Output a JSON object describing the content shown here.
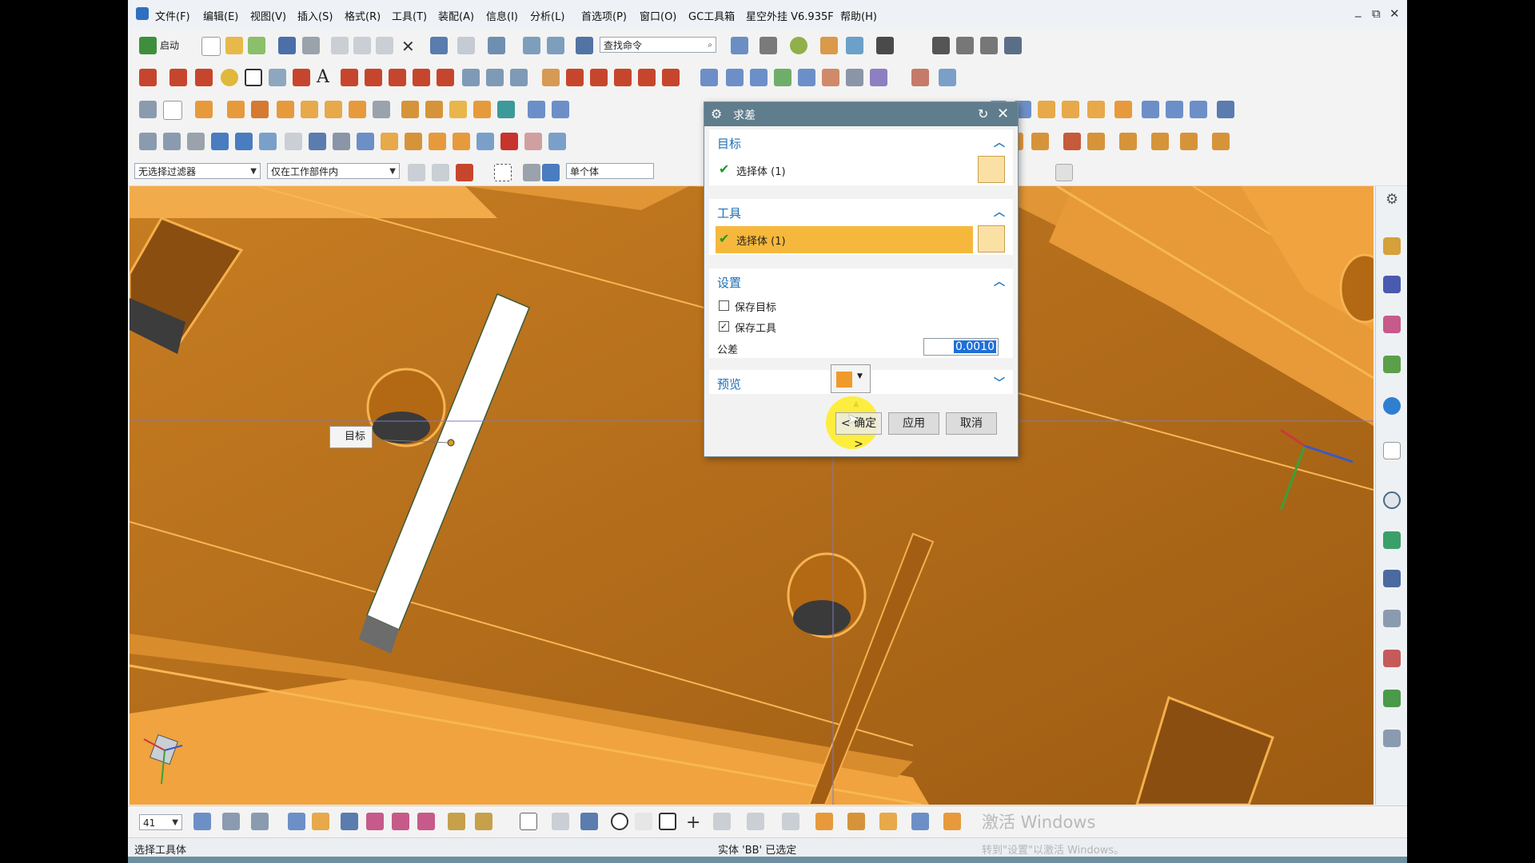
{
  "menubar": {
    "items": [
      "文件(F)",
      "编辑(E)",
      "视图(V)",
      "插入(S)",
      "格式(R)",
      "工具(T)",
      "装配(A)",
      "信息(I)",
      "分析(L)",
      "首选项(P)",
      "窗口(O)",
      "GC工具箱",
      "星空外挂 V6.935F",
      "帮助(H)"
    ],
    "window_controls": [
      "_",
      "⧉",
      "✕"
    ]
  },
  "toolbar": {
    "start_label": "启动",
    "search_placeholder": "查找命令"
  },
  "selection_bar": {
    "filter_value": "无选择过滤器",
    "scope_value": "仅在工作部件内",
    "body_mode_value": "单个体"
  },
  "dialog": {
    "title": "求差",
    "target_section": "目标",
    "target_select": "选择体 (1)",
    "tool_section": "工具",
    "tool_select": "选择体 (1)",
    "settings_section": "设置",
    "keep_target_label": "保存目标",
    "keep_target_checked": false,
    "keep_tool_label": "保存工具",
    "keep_tool_checked": true,
    "tolerance_label": "公差",
    "tolerance_value": "0.0010",
    "preview_section": "预览",
    "ok_label": "< 确定 >",
    "apply_label": "应用",
    "cancel_label": "取消"
  },
  "viewport": {
    "target_tag": "目标"
  },
  "bottombar": {
    "layer_value": "41"
  },
  "statusbar": {
    "prompt": "选择工具体",
    "message": "实体 'BB' 已选定"
  },
  "watermark": {
    "line1": "激活 Windows",
    "line2": "转到\"设置\"以激活 Windows。"
  },
  "colors": {
    "model_orange": "#b86f18",
    "dialog_title_bg": "#5f7d8c",
    "section_blue": "#1f6fb5",
    "highlight_row": "#f6b83c"
  }
}
